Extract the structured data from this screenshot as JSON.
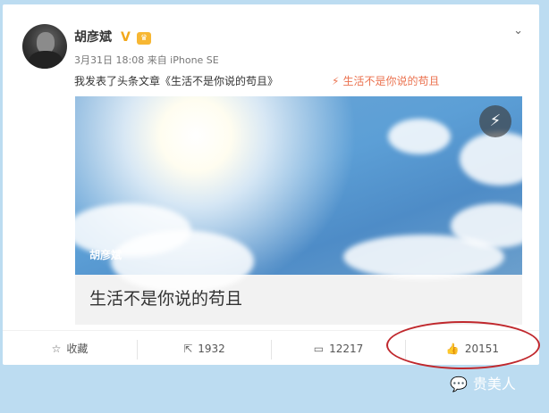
{
  "post": {
    "username": "胡彦斌",
    "verified_icon": "verified-v-icon",
    "vip_icon": "vip-badge-icon",
    "meta": "3月31日 18:08 来自 iPhone SE",
    "text": "我发表了头条文章《生活不是你说的苟且》",
    "link_icon": "lightning-icon",
    "link_label": "生活不是你说的苟且",
    "more_icon": "chevron-down-icon"
  },
  "article": {
    "cover_author": "胡彦斌",
    "title": "生活不是你说的苟且",
    "cover_icon": "lightning-icon"
  },
  "actions": [
    {
      "icon": "star-icon",
      "label": "收藏"
    },
    {
      "icon": "share-icon",
      "label": "1932"
    },
    {
      "icon": "comment-icon",
      "label": "12217"
    },
    {
      "icon": "thumbs-up-icon",
      "label": "20151"
    }
  ],
  "watermark": {
    "icon": "wechat-icon",
    "label": "贵美人"
  },
  "colors": {
    "background": "#bcdcf1",
    "link": "#eb7350",
    "highlight_circle": "#c0282d",
    "verified": "#f2a81b"
  }
}
